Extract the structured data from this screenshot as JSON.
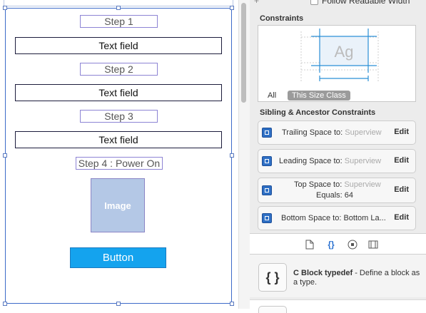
{
  "canvas": {
    "steps": [
      "Step 1",
      "Step 2",
      "Step 3",
      "Step 4 : Power On"
    ],
    "text_field_label": "Text field",
    "image_label": "Image",
    "button_label": "Button"
  },
  "inspector": {
    "readable_width_label": "Follow Readable Width",
    "constraints_title": "Constraints",
    "preview_text": "Ag",
    "filter_all": "All",
    "filter_size_class": "This Size Class",
    "sibling_title": "Sibling & Ancestor Constraints",
    "rows": [
      {
        "label": "Trailing Space to:",
        "target": "Superview",
        "edit": "Edit"
      },
      {
        "label": "Leading Space to:",
        "target": "Superview",
        "edit": "Edit"
      },
      {
        "label": "Top Space to:",
        "target": "Superview",
        "equals_label": "Equals:",
        "equals_value": "64",
        "edit": "Edit"
      },
      {
        "label": "Bottom Space to:",
        "target": "Bottom La...",
        "edit": "Edit"
      }
    ]
  },
  "library": {
    "tabs": [
      "file-template-icon",
      "code-snippet-icon",
      "object-icon",
      "media-icon"
    ],
    "snippet_icon_text": "{ }",
    "snippet_title": "C Block typedef",
    "snippet_desc": " - Define a block as a type."
  },
  "colors": {
    "selection": "#3d6bc9",
    "button": "#14a3ee",
    "image": "#b4c8e6",
    "constraint_blue": "#2a8fd6",
    "accent": "#2a71d0"
  }
}
